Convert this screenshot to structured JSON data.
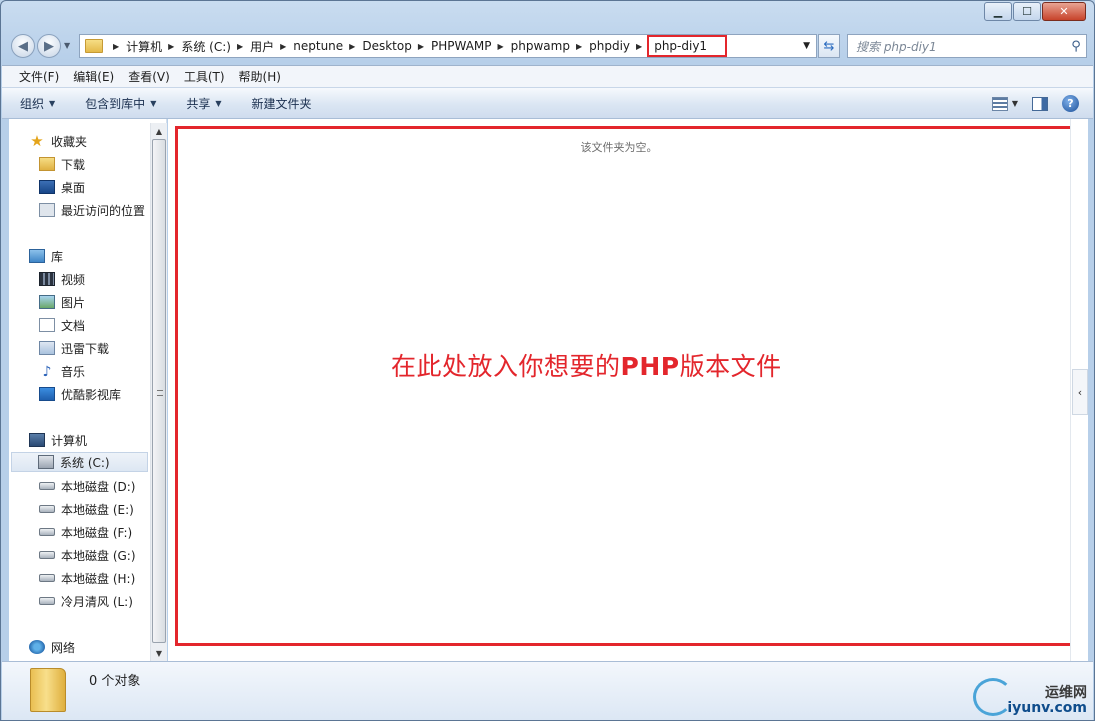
{
  "window": {
    "caption_buttons": [
      "minimize",
      "maximize",
      "close"
    ]
  },
  "address": {
    "breadcrumbs": [
      "计算机",
      "系统 (C:)",
      "用户",
      "neptune",
      "Desktop",
      "PHPWAMP",
      "phpwamp",
      "phpdiy"
    ],
    "current": "php-diy1",
    "highlight_color": "#e3262c"
  },
  "search": {
    "placeholder": "搜索 php-diy1"
  },
  "menu": [
    "文件(F)",
    "编辑(E)",
    "查看(V)",
    "工具(T)",
    "帮助(H)"
  ],
  "commands": {
    "organize": "组织",
    "include_library": "包含到库中",
    "share": "共享",
    "new_folder": "新建文件夹"
  },
  "nav": {
    "favorites": "收藏夹",
    "downloads": "下载",
    "desktop": "桌面",
    "recent": "最近访问的位置",
    "libraries": "库",
    "videos": "视频",
    "pictures": "图片",
    "documents": "文档",
    "xunlei": "迅雷下载",
    "music": "音乐",
    "youku": "优酷影视库",
    "computer": "计算机",
    "drive_c": "系统 (C:)",
    "drive_d": "本地磁盘 (D:)",
    "drive_e": "本地磁盘 (E:)",
    "drive_f": "本地磁盘 (F:)",
    "drive_g": "本地磁盘 (G:)",
    "drive_h": "本地磁盘 (H:)",
    "drive_l": "冷月清风 (L:)",
    "network": "网络"
  },
  "content": {
    "empty_message": "该文件夹为空。",
    "annotation_pre": "在此处放入你想要的",
    "annotation_php": "PHP",
    "annotation_post": "版本文件"
  },
  "details": {
    "count_text": "0 个对象"
  },
  "watermark": {
    "brand": "运维网",
    "url": "iyunv.com"
  }
}
